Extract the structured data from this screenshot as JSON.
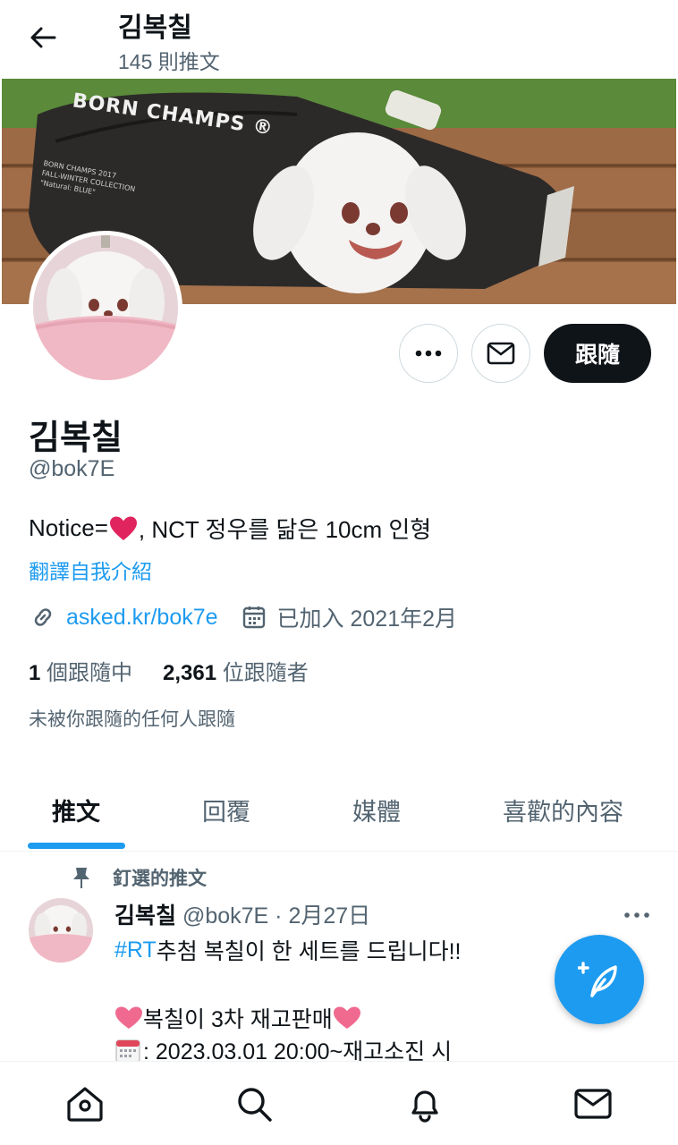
{
  "header": {
    "title": "김복칠",
    "tweet_count": "145 則推文"
  },
  "banner": {
    "bag_brand": "BORN CHAMPS ®",
    "bag_small_text": [
      "BORN CHAMPS 2017",
      "FALL-WINTER COLLECTION",
      "\"Natural: BLUE\""
    ]
  },
  "profile": {
    "name": "김복칠",
    "handle": "@bok7E",
    "bio_prefix": "Notice=",
    "bio_suffix": ", NCT 정우를 닮은 10cm 인형",
    "translate": "翻譯自我介紹",
    "link": "asked.kr/bok7e",
    "joined": "已加入 2021年2月",
    "following_count": "1",
    "following_label": " 個跟隨中",
    "followers_count": "2,361",
    "followers_label": " 位跟隨者",
    "not_followed": "未被你跟隨的任何人跟隨",
    "follow_button": "跟隨"
  },
  "tabs": [
    {
      "label": "推文",
      "active": true
    },
    {
      "label": "回覆",
      "active": false
    },
    {
      "label": "媒體",
      "active": false
    },
    {
      "label": "喜歡的內容",
      "active": false
    }
  ],
  "tweet": {
    "pinned_label": "釘選的推文",
    "author": "김복칠",
    "meta": " @bok7E · 2月27日",
    "hashtag": "#RT",
    "line1_rest": " 추첨 복칠이 한 세트를 드립니다!!",
    "line2_text": "복칠이 3차 재고판매",
    "line3_text": ": 2023.03.01 20:00~재고소진 시"
  },
  "icons": {
    "back": "arrow-left-icon",
    "more": "more-horizontal-icon",
    "message": "envelope-icon",
    "link": "link-icon",
    "calendar": "calendar-icon",
    "pin": "pin-icon",
    "compose": "compose-feather-icon",
    "nav": [
      "home-icon",
      "search-icon",
      "bell-icon",
      "envelope-icon"
    ]
  },
  "colors": {
    "accent": "#1d9bf0",
    "text": "#0f1419",
    "muted": "#536471",
    "heart": "#e0245e"
  }
}
